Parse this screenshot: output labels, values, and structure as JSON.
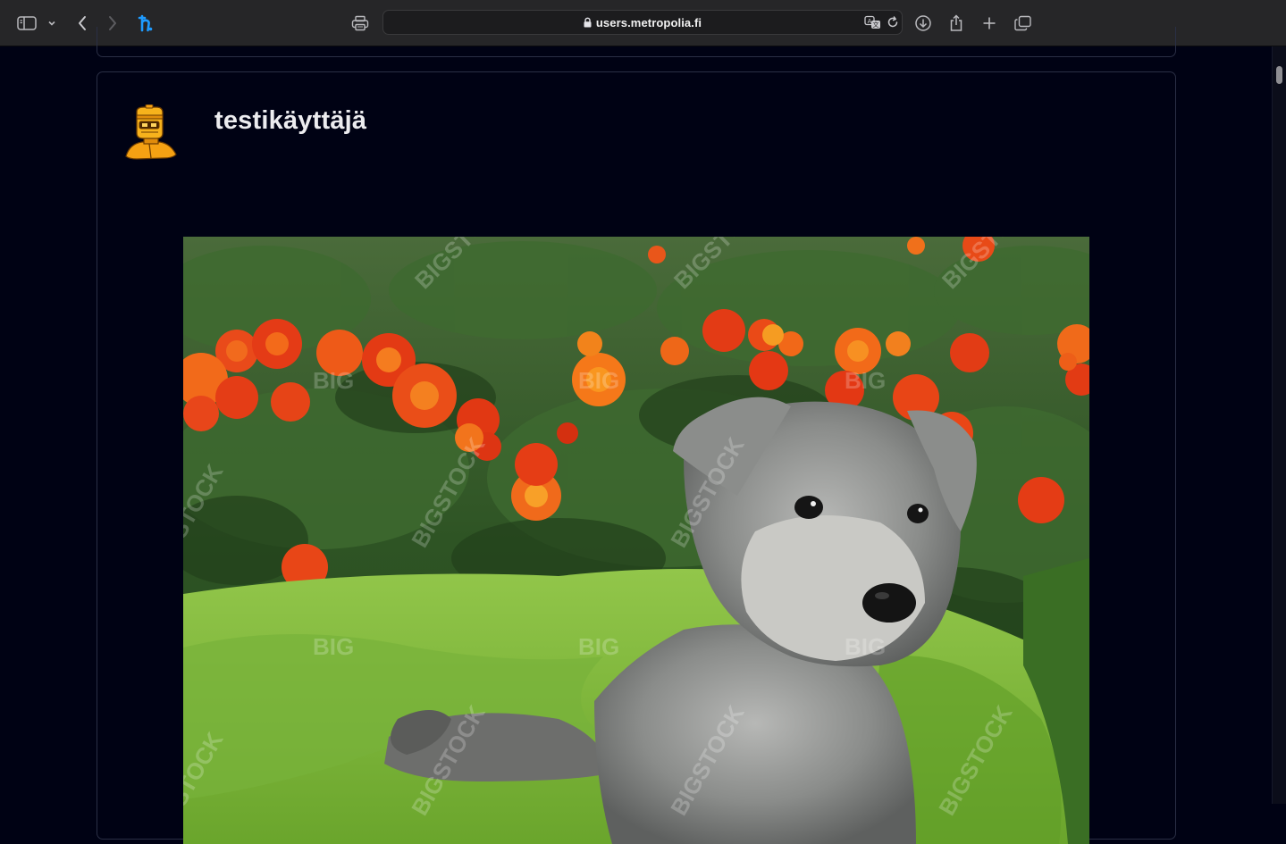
{
  "browser": {
    "url": "users.metropolia.fi",
    "icons": {
      "sidebar": "sidebar-icon",
      "sidebar_menu": "chevron-down-icon",
      "back": "chevron-left-icon",
      "forward": "chevron-right-icon",
      "extension": "hetzner-h-icon",
      "reader": "printer-icon",
      "lock": "lock-icon",
      "translate": "translate-icon",
      "reload": "reload-icon",
      "downloads": "download-icon",
      "share": "share-icon",
      "new_tab": "plus-icon",
      "tabs": "tabs-overview-icon"
    },
    "colors": {
      "toolbar": "#262628",
      "accent": "#1e9bff"
    }
  },
  "post": {
    "username": "testikäyttäjä",
    "avatar_icon": "robot-avatar-icon",
    "image_description": "puppy-in-basket-photo",
    "watermark": [
      "BIG",
      "BIGSTOCK",
      "STOCK"
    ]
  },
  "page": {
    "background": "#000214",
    "card_border": "#2a2f45"
  }
}
